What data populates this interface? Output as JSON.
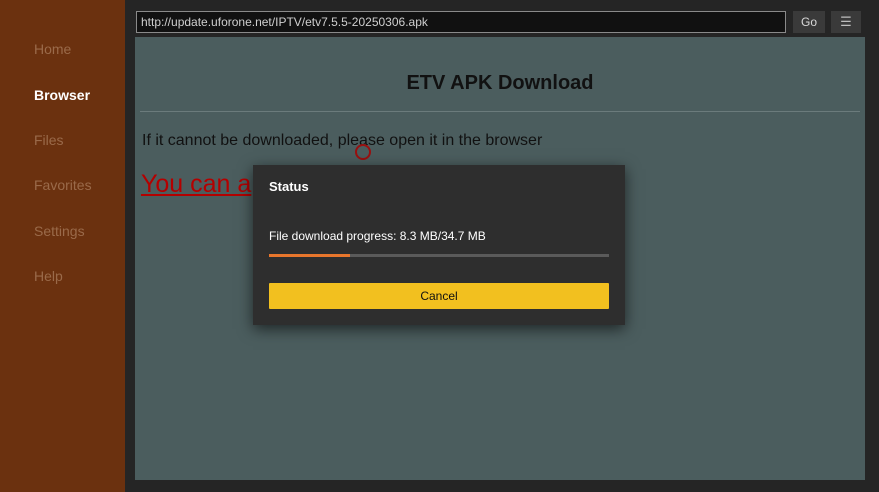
{
  "sidebar": {
    "items": [
      {
        "label": "Home"
      },
      {
        "label": "Browser"
      },
      {
        "label": "Files"
      },
      {
        "label": "Favorites"
      },
      {
        "label": "Settings"
      },
      {
        "label": "Help"
      }
    ],
    "active": "Browser"
  },
  "toolbar": {
    "url": "http://update.uforone.net/IPTV/etv7.5.5-20250306.apk",
    "go_label": "Go",
    "menu_icon": "menu-icon"
  },
  "page": {
    "title": "ETV APK Download",
    "info": "If it cannot be downloaded, please open it in the browser",
    "link": "You can a"
  },
  "dialog": {
    "title": "Status",
    "progress_text": "File download progress: 8.3 MB/34.7 MB",
    "progress_fraction": 0.239,
    "cancel_label": "Cancel"
  },
  "colors": {
    "sidebar": "#6b310f",
    "webview_bg": "#4b5d5e",
    "progress": "#e8762c",
    "cancel_button": "#f2c01f",
    "link": "#b40000"
  }
}
